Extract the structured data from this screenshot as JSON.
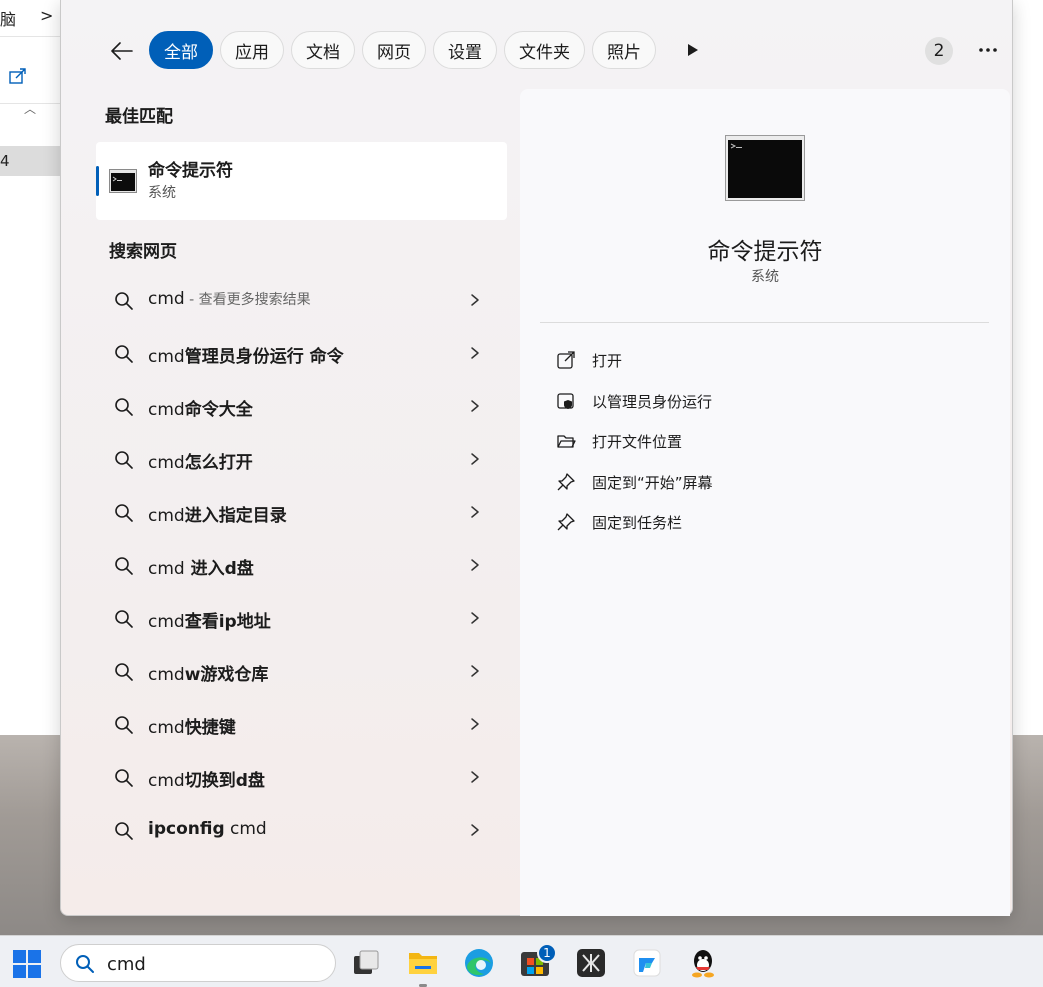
{
  "background": {
    "crumb": "脑",
    "crumb_arrow": ">",
    "selected_item": "4"
  },
  "tabs": [
    {
      "label": "全部",
      "active": true
    },
    {
      "label": "应用"
    },
    {
      "label": "文档"
    },
    {
      "label": "网页"
    },
    {
      "label": "设置"
    },
    {
      "label": "文件夹"
    },
    {
      "label": "照片"
    }
  ],
  "header": {
    "count_badge": "2",
    "overflow_icon": "ellipsis-icon",
    "back_icon": "arrow-left-icon",
    "more_icon": "play-triangle-icon"
  },
  "best_match": {
    "title": "最佳匹配",
    "name": "命令提示符",
    "type": "系统"
  },
  "web": {
    "title": "搜索网页",
    "results": [
      {
        "prefix": "cmd",
        "rest": "",
        "hint": " - 查看更多搜索结果",
        "bold_rest": false
      },
      {
        "prefix": "cmd",
        "rest": "管理员身份运行 命令",
        "hint": "",
        "bold_rest": true
      },
      {
        "prefix": "cmd",
        "rest": "命令大全",
        "hint": "",
        "bold_rest": true
      },
      {
        "prefix": "cmd",
        "rest": "怎么打开",
        "hint": "",
        "bold_rest": true
      },
      {
        "prefix": "cmd",
        "rest": "进入指定目录",
        "hint": "",
        "bold_rest": true
      },
      {
        "prefix": "cmd",
        "rest": " 进入d盘",
        "hint": "",
        "bold_rest": true
      },
      {
        "prefix": "cmd",
        "rest": "查看ip地址",
        "hint": "",
        "bold_rest": true
      },
      {
        "prefix": "cmd",
        "rest": "w游戏仓库",
        "hint": "",
        "bold_rest": true
      },
      {
        "prefix": "cmd",
        "rest": "快捷键",
        "hint": "",
        "bold_rest": true
      },
      {
        "prefix": "cmd",
        "rest": "切换到d盘",
        "hint": "",
        "bold_rest": true
      },
      {
        "prefix": "ipconfig",
        "rest": " cmd",
        "hint": "",
        "bold_rest": false,
        "bold_prefix": true
      }
    ]
  },
  "detail": {
    "name": "命令提示符",
    "type": "系统",
    "actions": [
      {
        "label": "打开",
        "icon": "open-external-icon"
      },
      {
        "label": "以管理员身份运行",
        "icon": "shield-admin-icon"
      },
      {
        "label": "打开文件位置",
        "icon": "folder-open-icon"
      },
      {
        "label": "固定到“开始”屏幕",
        "icon": "pin-icon"
      },
      {
        "label": "固定到任务栏",
        "icon": "pin-icon"
      }
    ]
  },
  "taskbar": {
    "search_value": "cmd",
    "store_badge": "1",
    "apps": [
      "task-view-icon",
      "file-explorer-icon",
      "edge-icon",
      "store-icon",
      "app-k-icon",
      "feishu-icon",
      "qq-icon"
    ]
  },
  "colors": {
    "accent": "#005fb8",
    "panel_bg": "#f4f3f5",
    "detail_bg": "#f9f9fb"
  }
}
